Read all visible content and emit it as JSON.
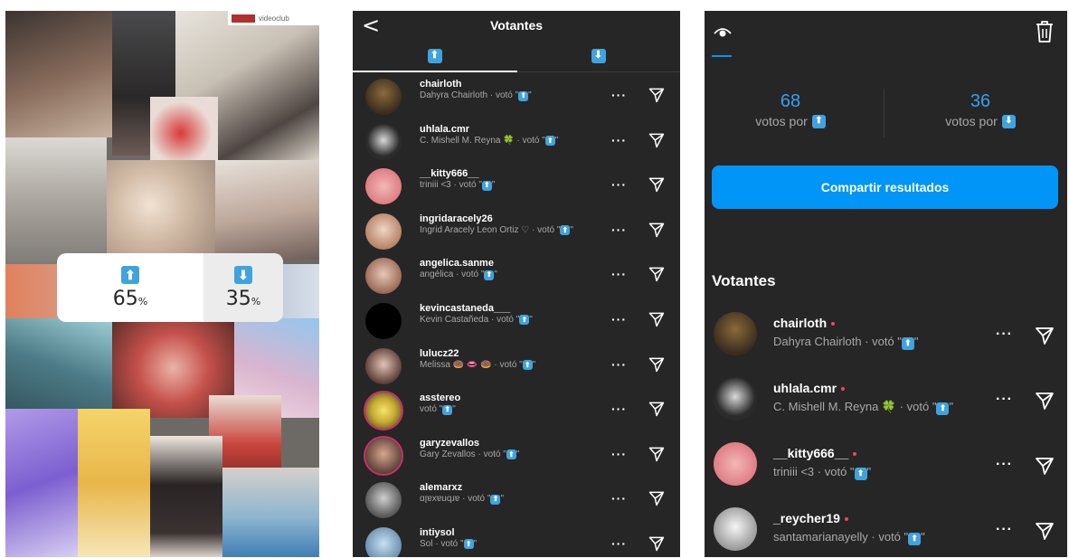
{
  "story": {
    "watermark": "videoclub",
    "poll": {
      "up_value": 65,
      "up_symbol": "%",
      "down_value": 35,
      "down_symbol": "%"
    }
  },
  "voters_screen": {
    "back_label": "<",
    "title": "Votantes",
    "active_tab": "up",
    "voted_prefix": "votó",
    "voters": [
      {
        "username": "chairloth",
        "name": "Dahyra Chairloth"
      },
      {
        "username": "uhlala.cmr",
        "name": "C. Mishell M. Reyna 🍀"
      },
      {
        "username": "__kitty666__",
        "name": "triniii <3"
      },
      {
        "username": "ingridaracely26",
        "name": "Ingrid Aracely Leon Ortiz ♡"
      },
      {
        "username": "angelica.sanme",
        "name": "angélica"
      },
      {
        "username": "kevincastaneda___",
        "name": "Kevin Castañeda"
      },
      {
        "username": "lulucz22",
        "name": "Melissa 🍩 👄 🍩"
      },
      {
        "username": "asstereo",
        "name": ""
      },
      {
        "username": "garyzevallos",
        "name": "Gary Zevallos"
      },
      {
        "username": "alemarxz",
        "name": "ɑןɐxɐuqɹɐ"
      },
      {
        "username": "intiysol",
        "name": "Sol"
      }
    ]
  },
  "results_screen": {
    "up_count": "68",
    "down_count": "36",
    "votes_label": "votos por",
    "share_button": "Compartir resultados",
    "voters_heading": "Votantes",
    "voted_prefix": "votó",
    "voters": [
      {
        "username": "chairloth",
        "name": "Dahyra Chairloth"
      },
      {
        "username": "uhlala.cmr",
        "name": "C. Mishell M. Reyna 🍀"
      },
      {
        "username": "__kitty666__",
        "name": "triniii <3"
      },
      {
        "username": "_reycher19",
        "name": "santamarianayelly"
      }
    ]
  },
  "colors": {
    "dark_bg": "#262626",
    "accent_blue": "#0095f6",
    "count_blue": "#3b9ef0",
    "emoji_blue": "#3fa3dd",
    "new_dot": "#ed4956"
  },
  "icons": {
    "up": "up-arrow-emoji-icon",
    "down": "down-arrow-emoji-icon",
    "send": "send-paper-plane-icon",
    "more": "more-options-icon",
    "eye": "eye-icon",
    "trash": "trash-icon"
  }
}
